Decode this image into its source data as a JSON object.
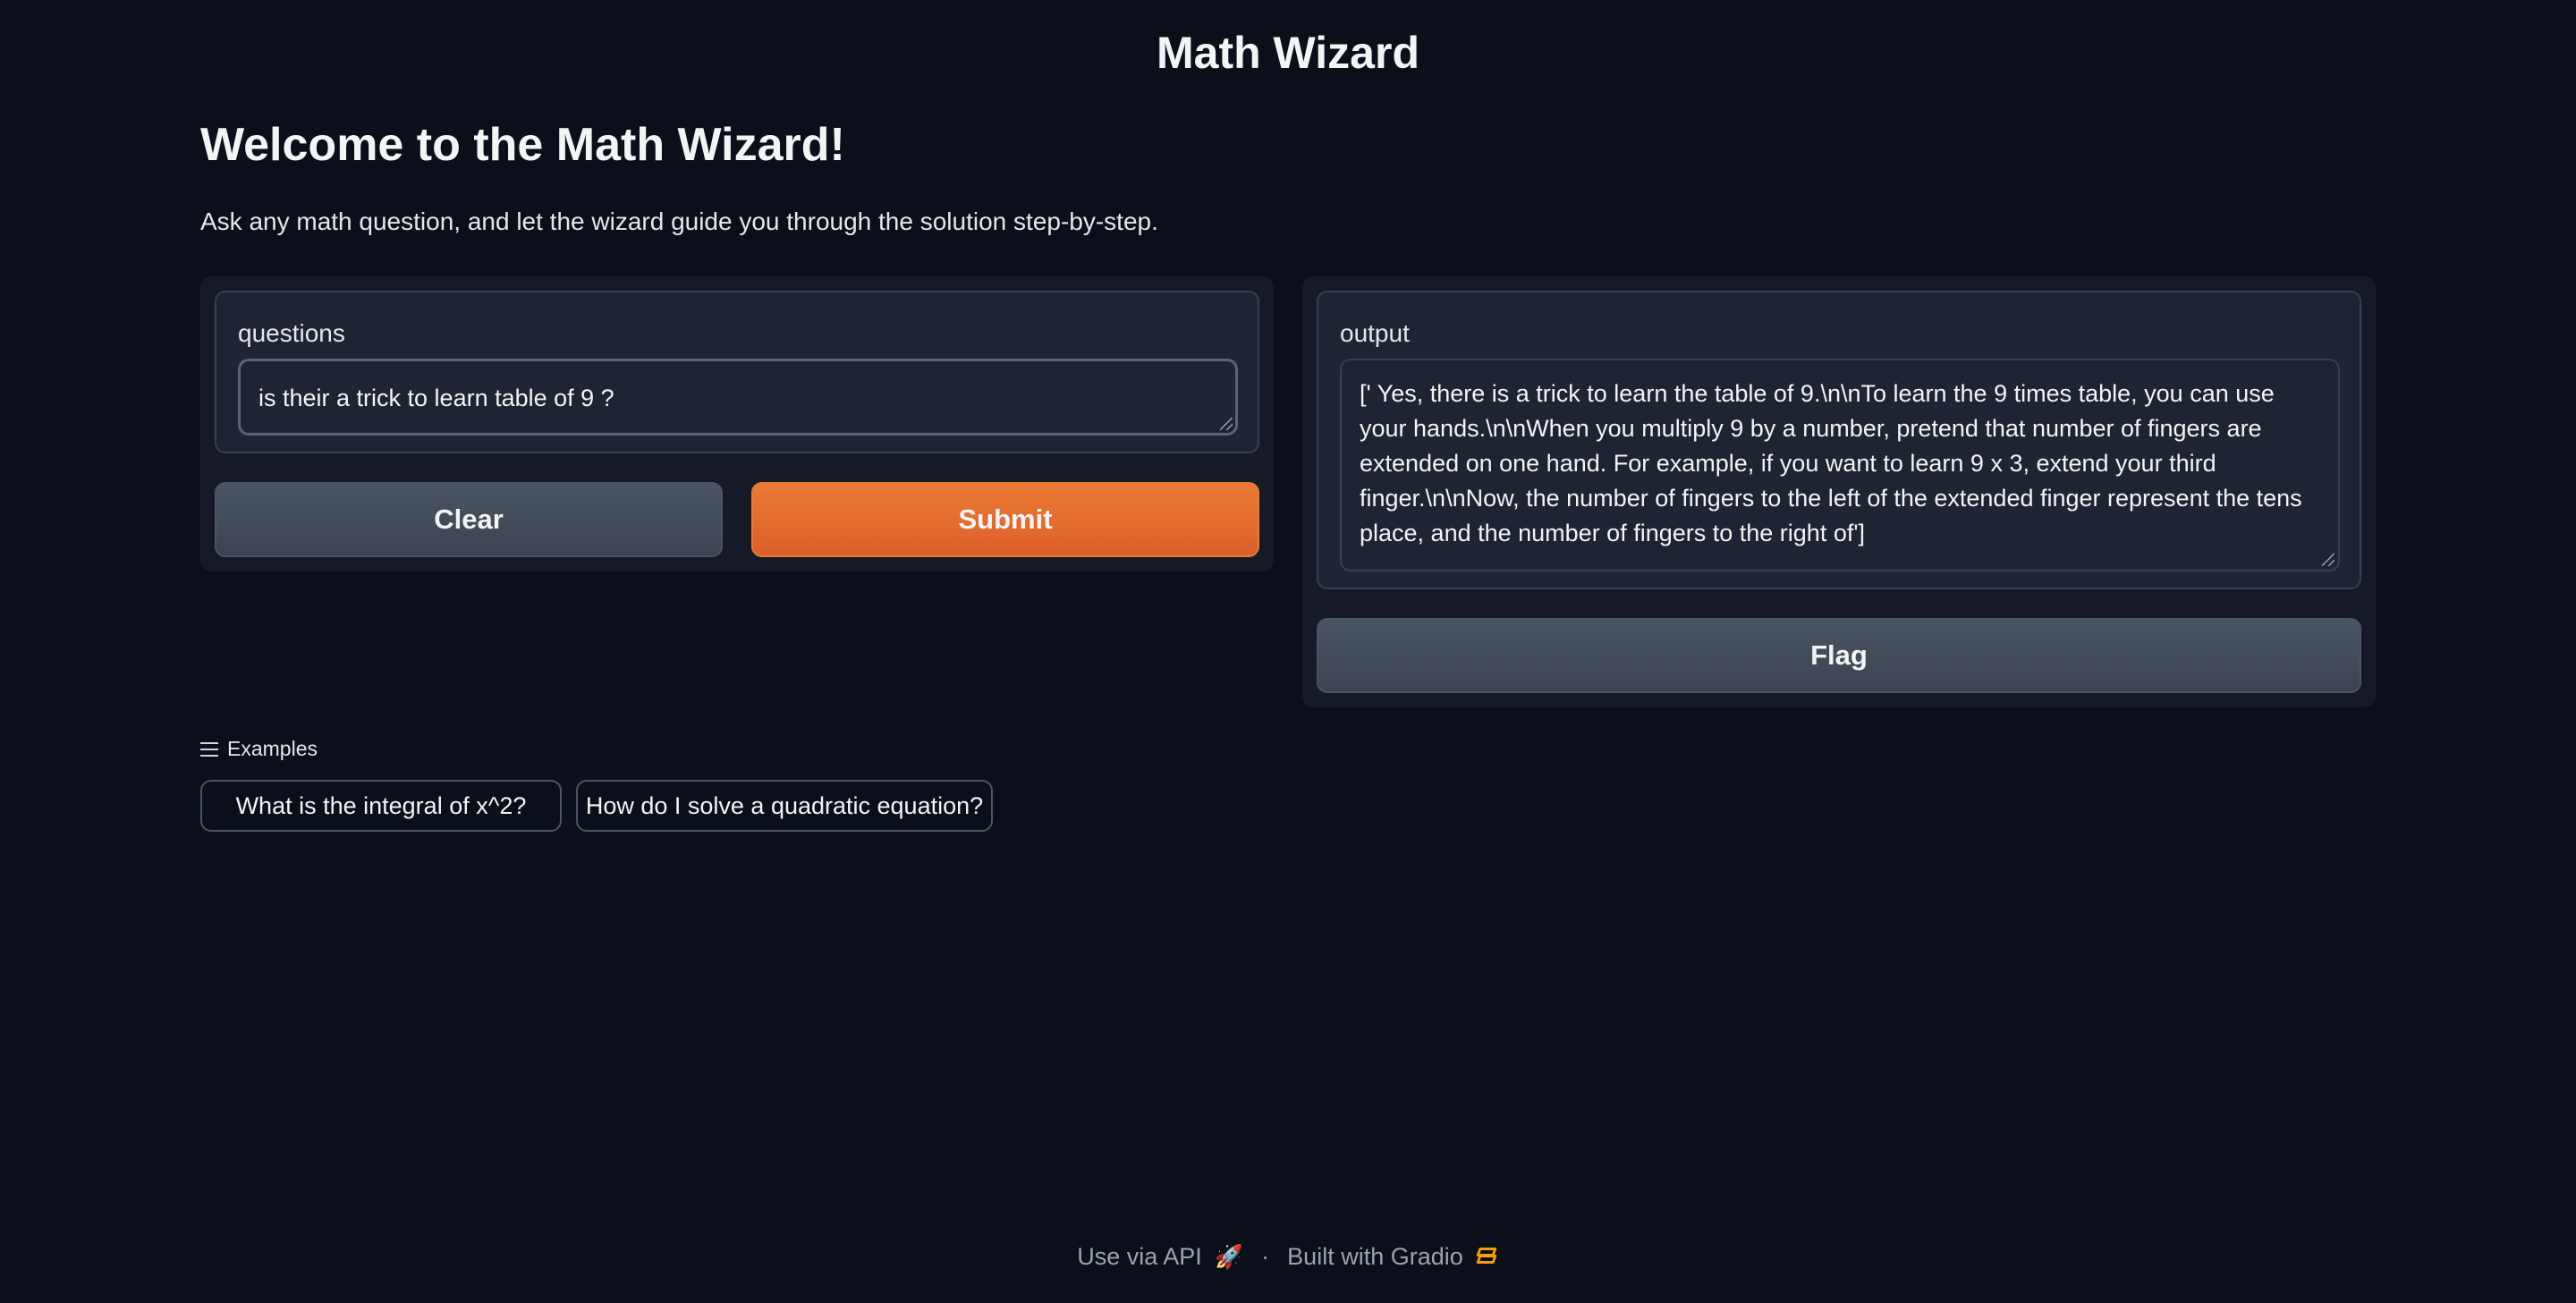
{
  "app": {
    "title": "Math Wizard",
    "heading": "Welcome to the Math Wizard!",
    "description": "Ask any math question, and let the wizard guide you through the solution step-by-step."
  },
  "input": {
    "label": "questions",
    "value": "is their a trick to learn table of 9 ?"
  },
  "buttons": {
    "clear": "Clear",
    "submit": "Submit",
    "flag": "Flag"
  },
  "output": {
    "label": "output",
    "value": "[' Yes, there is a trick to learn the table of 9.\\n\\nTo learn the 9 times table, you can use your hands.\\n\\nWhen you multiply 9 by a number, pretend that number of fingers are extended on one hand. For example, if you want to learn 9 x 3, extend your third finger.\\n\\nNow, the number of fingers to the left of the extended finger represent the tens place, and the number of fingers to the right of']"
  },
  "examples": {
    "header": "Examples",
    "icon": "list-icon",
    "items": [
      "What is the integral of x^2?",
      "How do I solve a quadratic equation?"
    ]
  },
  "footer": {
    "api_link": "Use via API",
    "api_icon": "rocket-icon",
    "separator": "·",
    "built_with": "Built with Gradio",
    "gradio_icon": "gradio-logo-icon"
  },
  "colors": {
    "background": "#0b0f19",
    "panel": "#151a26",
    "block": "#1f2432",
    "primary": "#ea7b34",
    "secondary": "#4b5563"
  }
}
